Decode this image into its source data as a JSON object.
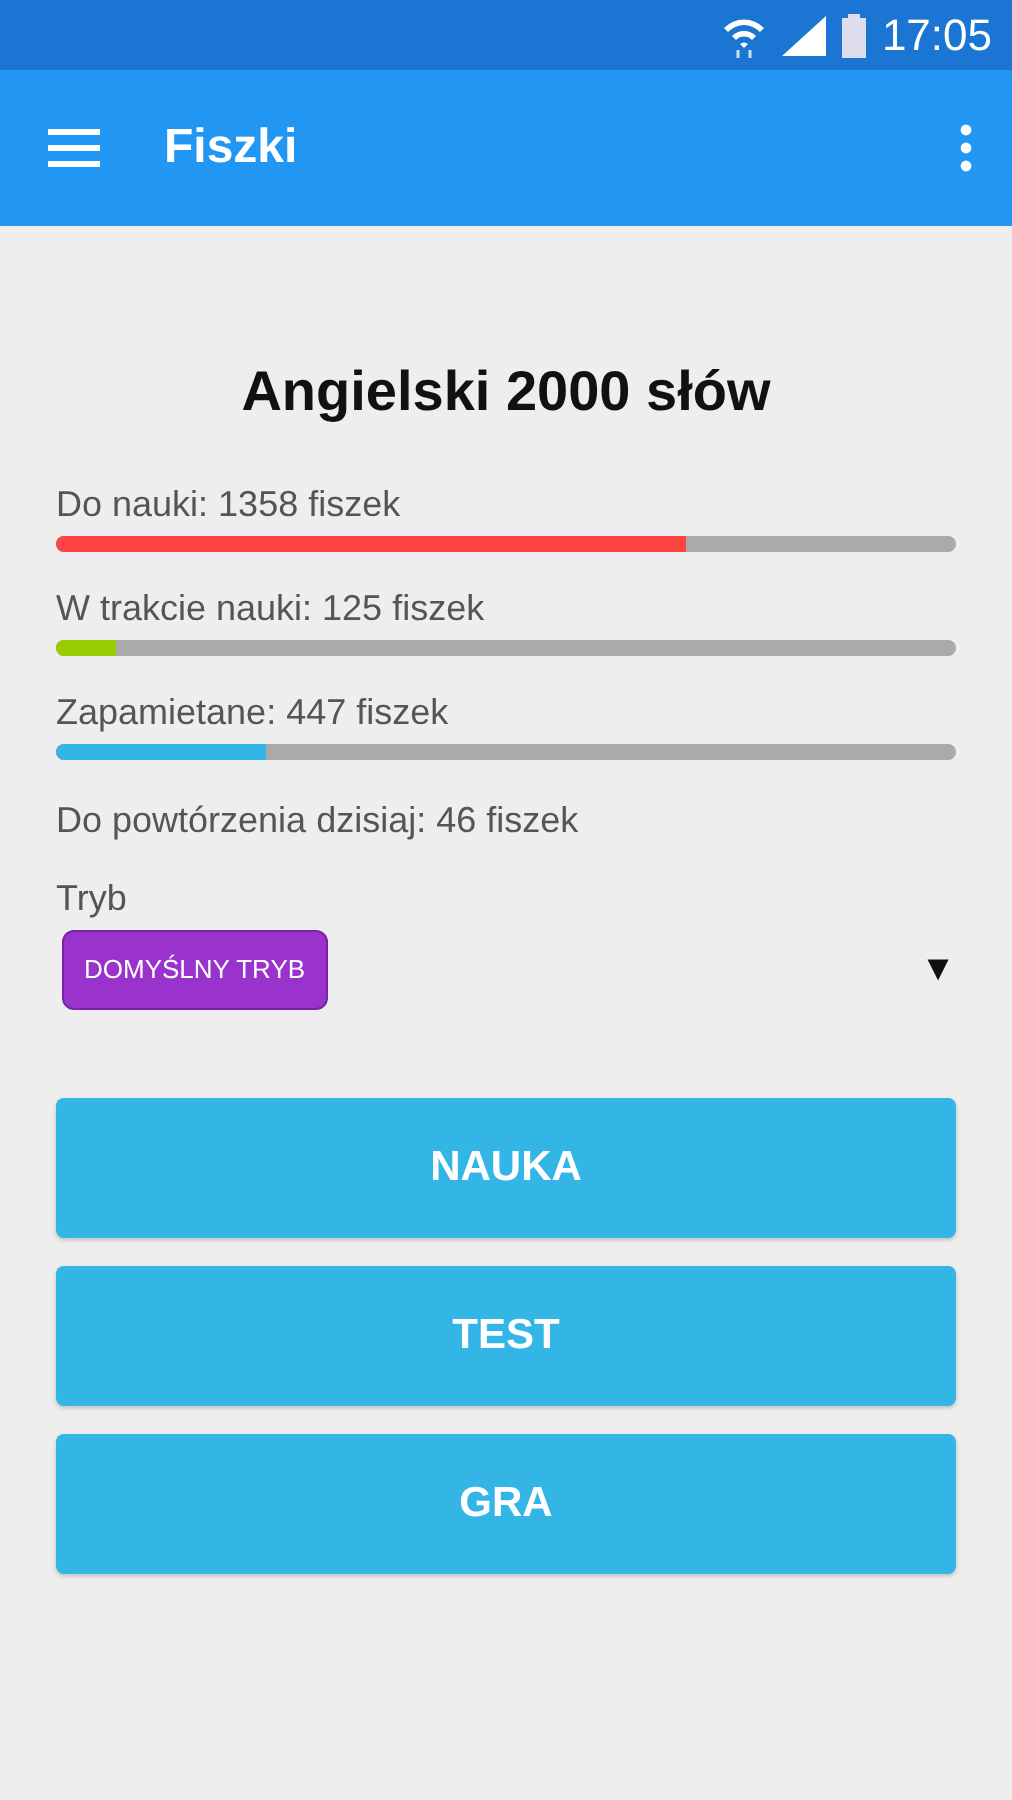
{
  "status_bar": {
    "time": "17:05"
  },
  "app_bar": {
    "title": "Fiszki"
  },
  "deck": {
    "title": "Angielski 2000 słów"
  },
  "progress": [
    {
      "label": "Do nauki: 1358 fiszek",
      "level": 0.7,
      "color": "#ff4444"
    },
    {
      "label": "W trakcie nauki: 125 fiszek",
      "level": 0.067,
      "color": "#99cc00"
    },
    {
      "label": "Zapamietane: 447 fiszek",
      "level": 0.233,
      "color": "#33b5e5"
    }
  ],
  "due_today": "Do powtórzenia dzisiaj: 46 fiszek",
  "mode": {
    "label": "Tryb",
    "value": "DOMYŚLNY TRYB",
    "arrow": "▼"
  },
  "buttons": [
    "NAUKA",
    "TEST",
    "GRA"
  ]
}
